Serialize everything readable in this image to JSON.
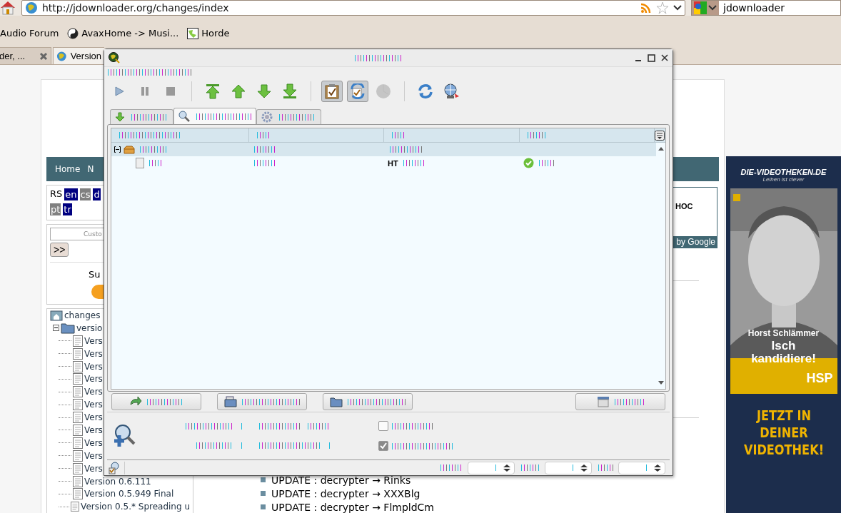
{
  "browser": {
    "url": "http://jdownloader.org/changes/index",
    "search_value": "jdownloader",
    "bookmarks": [
      {
        "label": "Audio Forum",
        "kind": "none"
      },
      {
        "label": "AvaxHome -> Musi...",
        "kind": "yinyang"
      },
      {
        "label": "Horde",
        "kind": "horde"
      }
    ],
    "tabs": [
      {
        "label": "der, ...",
        "selected": false,
        "closable": true
      },
      {
        "label": "Version",
        "selected": true,
        "closable": false
      }
    ]
  },
  "page": {
    "nav": [
      "Home",
      "N"
    ],
    "rss_label": "RS",
    "languages": [
      {
        "code": "en",
        "color": "#000080"
      },
      {
        "code": "cs",
        "color": "#808080"
      },
      {
        "code": "d",
        "color": "#000080"
      },
      {
        "code": "pt",
        "color": "#808080"
      },
      {
        "code": "tr",
        "color": "#000080"
      }
    ],
    "search_placeholder": "Custo",
    "search_button": ">>",
    "subscribe_label": "Su",
    "tree": {
      "label": "changes",
      "children": [
        {
          "label": "versio",
          "expanded": true,
          "children": [
            {
              "label": "Vers"
            },
            {
              "label": "Vers"
            },
            {
              "label": "Vers"
            },
            {
              "label": "Vers"
            },
            {
              "label": "Vers"
            },
            {
              "label": "Vers"
            },
            {
              "label": "Vers"
            },
            {
              "label": "Vers"
            },
            {
              "label": "Vers"
            },
            {
              "label": "Vers"
            },
            {
              "label": "Vers"
            },
            {
              "label": "Version 0.6.111"
            },
            {
              "label": "Version 0.5.949 Final"
            },
            {
              "label": "Version 0.5.* Spreading u"
            }
          ]
        }
      ]
    },
    "ad_box": {
      "title": "HOC",
      "footer": "by Google"
    },
    "updates": [
      "UPDATE : decrypter → Rinks",
      "UPDATE : decrypter → XXXBlg",
      "UPDATE : decrypter → FlmpldCm"
    ],
    "banner": {
      "site": "DIE-VIDEOTHEKEN.DE",
      "slogan": "Leihen ist clever",
      "name": "Horst Schlämmer",
      "claim": [
        "Isch",
        "kandidiere!"
      ],
      "party": "HSP",
      "call": [
        "JETZT IN",
        "DEINER",
        "VIDEOTHEK!"
      ]
    }
  },
  "app": {
    "toolbar": [
      {
        "kind": "play",
        "pressed": false,
        "disabled": false
      },
      {
        "kind": "pause",
        "pressed": false,
        "disabled": false
      },
      {
        "kind": "stop",
        "pressed": false,
        "disabled": false
      },
      {
        "kind": "sep"
      },
      {
        "kind": "top",
        "pressed": false,
        "disabled": false
      },
      {
        "kind": "up",
        "pressed": false,
        "disabled": false
      },
      {
        "kind": "down",
        "pressed": false,
        "disabled": false
      },
      {
        "kind": "bottom",
        "pressed": false,
        "disabled": false
      },
      {
        "kind": "sep"
      },
      {
        "kind": "clipboard",
        "pressed": true,
        "disabled": false
      },
      {
        "kind": "reconnect",
        "pressed": true,
        "disabled": false
      },
      {
        "kind": "premium",
        "pressed": false,
        "disabled": true
      },
      {
        "kind": "sep"
      },
      {
        "kind": "refresh",
        "pressed": false,
        "disabled": false
      },
      {
        "kind": "globe",
        "pressed": false,
        "disabled": false
      }
    ],
    "tabs": [
      {
        "kind": "downloads",
        "selected": false
      },
      {
        "kind": "linkgrabber",
        "selected": true
      },
      {
        "kind": "settings",
        "selected": false
      }
    ],
    "rows": [
      {
        "kind": "package",
        "expanded": true,
        "selected": true
      },
      {
        "kind": "file",
        "selected": false,
        "hoster_prefix": "HT",
        "status_ok": true
      }
    ],
    "buttons": [
      {
        "kind": "add-url"
      },
      {
        "kind": "add-container"
      },
      {
        "kind": "continue"
      },
      {
        "kind": "clear"
      }
    ],
    "options": [
      {
        "checked": false
      },
      {
        "checked": true
      }
    ]
  }
}
